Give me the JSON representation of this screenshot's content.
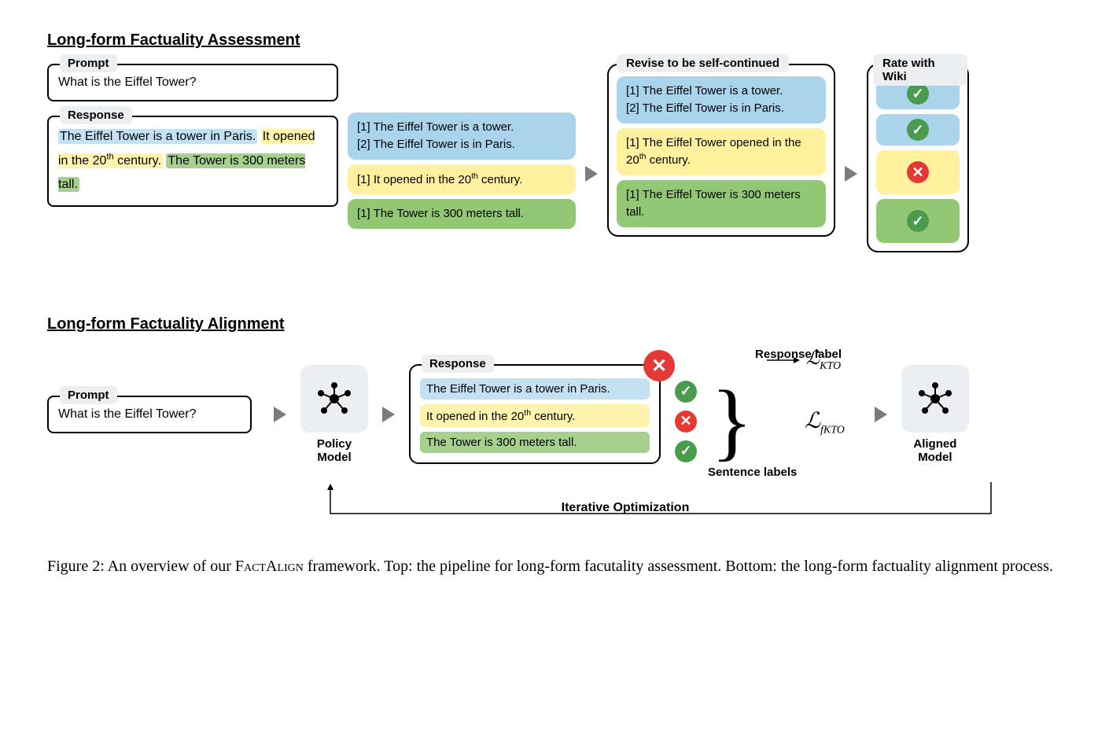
{
  "assessment": {
    "title": "Long-form Factuality Assessment",
    "prompt_label": "Prompt",
    "prompt_text": "What is the Eiffel Tower?",
    "response_label": "Response",
    "response_sentences": {
      "s1": "The Eiffel Tower is a tower in Paris.",
      "s2": "It opened in the 20ᵗʰ century.",
      "s3": "The Tower is 300 meters tall."
    },
    "facts": {
      "blue1": "[1] The Eiffel Tower is a tower.",
      "blue2": "[2] The Eiffel Tower is in Paris.",
      "yellow1": "[1] It opened in the 20ᵗʰ century.",
      "green1": "[1] The Tower is 300 meters tall."
    },
    "revised_label": "Revise to be self-continued",
    "revised": {
      "blue1": "[1] The Eiffel Tower is a tower.",
      "blue2": "[2] The Eiffel Tower is in Paris.",
      "yellow1": "[1] The Eiffel Tower opened in the 20ᵗʰ century.",
      "green1": "[1] The Eiffel Tower is 300 meters tall."
    },
    "rate_label": "Rate with Wiki"
  },
  "alignment": {
    "title": "Long-form Factuality Alignment",
    "prompt_label": "Prompt",
    "prompt_text": "What is the Eiffel Tower?",
    "policy_model": "Policy Model",
    "aligned_model": "Aligned Model",
    "response_label": "Response",
    "response_label_title": "Response label",
    "sentence_labels_title": "Sentence labels",
    "sentences": {
      "s1": "The Eiffel Tower is a tower in Paris.",
      "s2": "It opened in the 20ᵗʰ century.",
      "s3": "The Tower is 300 meters tall."
    },
    "loss_kto": "ℒ",
    "loss_kto_sub": "KTO",
    "loss_fkto": "ℒ",
    "loss_fkto_sub": "fKTO",
    "iterative": "Iterative Optimization"
  },
  "caption": "Figure 2: An overview of our FᴀᴄᴛAʟɪɢɴ framework. Top: the pipeline for long-form facutality assessment. Bottom: the long-form factuality alignment process."
}
